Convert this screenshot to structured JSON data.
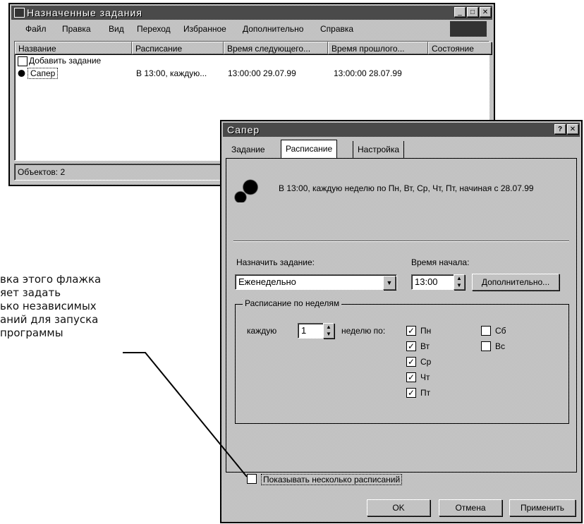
{
  "callout": {
    "lines": [
      "вка этого флажка",
      "яет задать",
      "ько независимых",
      "аний для запуска",
      "программы"
    ]
  },
  "window1": {
    "title": "Назначенные задания",
    "menu": [
      "Файл",
      "Правка",
      "Вид",
      "Переход",
      "Избранное",
      "Дополнительно",
      "Справка"
    ],
    "columns": [
      "Название",
      "Расписание",
      "Время следующего...",
      "Время прошлого...",
      "Состояние"
    ],
    "rows": [
      {
        "name": "Добавить задание",
        "schedule": "",
        "next": "",
        "prev": "",
        "state": "",
        "icon": "add-task-icon"
      },
      {
        "name": "Сапер",
        "schedule": "В 13:00, каждую...",
        "next": "13:00:00  29.07.99",
        "prev": "13:00:00  28.07.99",
        "state": "",
        "icon": "minesweeper-icon"
      }
    ],
    "status": "Объектов: 2"
  },
  "dialog": {
    "title": "Сапер",
    "tabs": [
      "Задание",
      "Расписание",
      "Настройка"
    ],
    "active_tab": "Расписание",
    "summary": "В 13:00, каждую неделю по Пн, Вт, Ср, Чт, Пт, начиная с 28.07.99",
    "assign_label": "Назначить задание:",
    "assign_value": "Еженедельно",
    "start_label": "Время начала:",
    "start_value": "13:00",
    "advanced_button": "Дополнительно...",
    "group_title": "Расписание по неделям",
    "every_label": "каждую",
    "every_value": "1",
    "week_label": "неделю по:",
    "days": [
      {
        "label": "Пн",
        "checked": true
      },
      {
        "label": "Вт",
        "checked": true
      },
      {
        "label": "Ср",
        "checked": true
      },
      {
        "label": "Чт",
        "checked": true
      },
      {
        "label": "Пт",
        "checked": true
      },
      {
        "label": "Сб",
        "checked": false
      },
      {
        "label": "Вс",
        "checked": false
      }
    ],
    "multi_label": "Показывать несколько расписаний",
    "multi_checked": false,
    "ok": "OK",
    "cancel": "Отмена",
    "apply": "Применить"
  },
  "colors": {
    "titlebar": "#4a4a4a",
    "face": "#d6d6d6",
    "window": "#ffffff"
  },
  "icons": [
    "help-icon",
    "close-icon",
    "minimize-icon",
    "maximize-icon",
    "dropdown-arrow-icon",
    "spin-up-icon",
    "spin-down-icon"
  ]
}
